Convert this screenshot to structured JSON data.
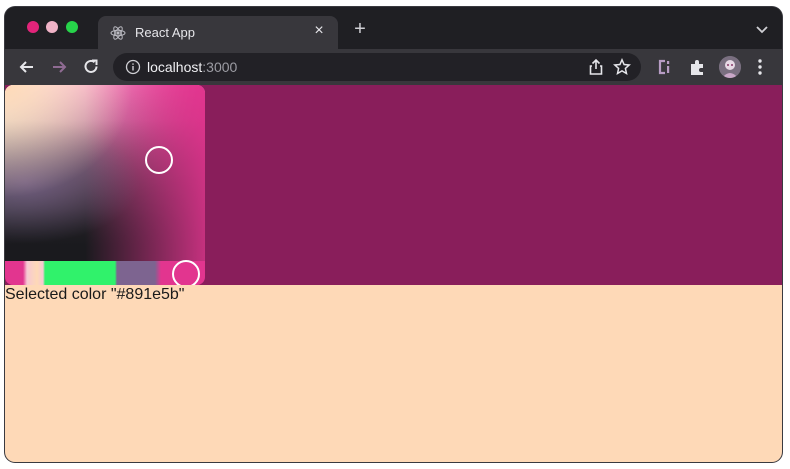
{
  "browser": {
    "traffic_colors": {
      "close": "#e2247a",
      "minimize": "#f0b3c7",
      "maximize": "#27d34a"
    },
    "tab": {
      "title": "React App",
      "icon": "react-icon",
      "close_label": "×"
    },
    "new_tab_label": "+",
    "toolbar": {
      "url_host": "localhost",
      "url_port": ":3000",
      "icons": [
        "back-arrow-icon",
        "forward-arrow-icon",
        "reload-icon",
        "info-icon",
        "share-icon",
        "star-icon",
        "extension-c-icon",
        "puzzle-icon",
        "avatar",
        "more-icon"
      ]
    }
  },
  "page": {
    "background": "#fed9b7",
    "selected_color": "#891e5b",
    "caption_prefix": "Selected color ",
    "caption": "Selected color \"#891e5b\"",
    "picker": {
      "hue_color": "#e2358f",
      "palette": [
        "#e2358f",
        "#f6c9d3",
        "#fed9b7",
        "#30f26b",
        "#7d6490",
        "#e2358f"
      ]
    }
  }
}
